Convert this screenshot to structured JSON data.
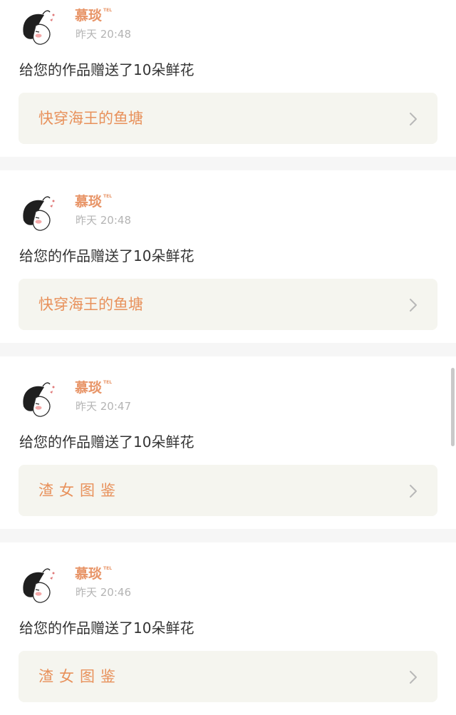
{
  "notifications": [
    {
      "username": "慕琰",
      "badge": "TEL",
      "time": "昨天 20:48",
      "message": "给您的作品赠送了10朵鲜花",
      "work_title": "快穿海王的鱼塘"
    },
    {
      "username": "慕琰",
      "badge": "TEL",
      "time": "昨天 20:48",
      "message": "给您的作品赠送了10朵鲜花",
      "work_title": "快穿海王的鱼塘"
    },
    {
      "username": "慕琰",
      "badge": "TEL",
      "time": "昨天 20:47",
      "message": "给您的作品赠送了10朵鲜花",
      "work_title": "渣女图鉴"
    },
    {
      "username": "慕琰",
      "badge": "TEL",
      "time": "昨天 20:46",
      "message": "给您的作品赠送了10朵鲜花",
      "work_title": "渣女图鉴"
    }
  ],
  "colors": {
    "accent": "#e89568",
    "work_link_bg": "#f5f5ef",
    "separator": "#f6f6f6",
    "timestamp": "#b4b4b4"
  },
  "icons": {
    "avatar": "avatar-cartoon-girl",
    "chevron": "chevron-right-icon"
  }
}
